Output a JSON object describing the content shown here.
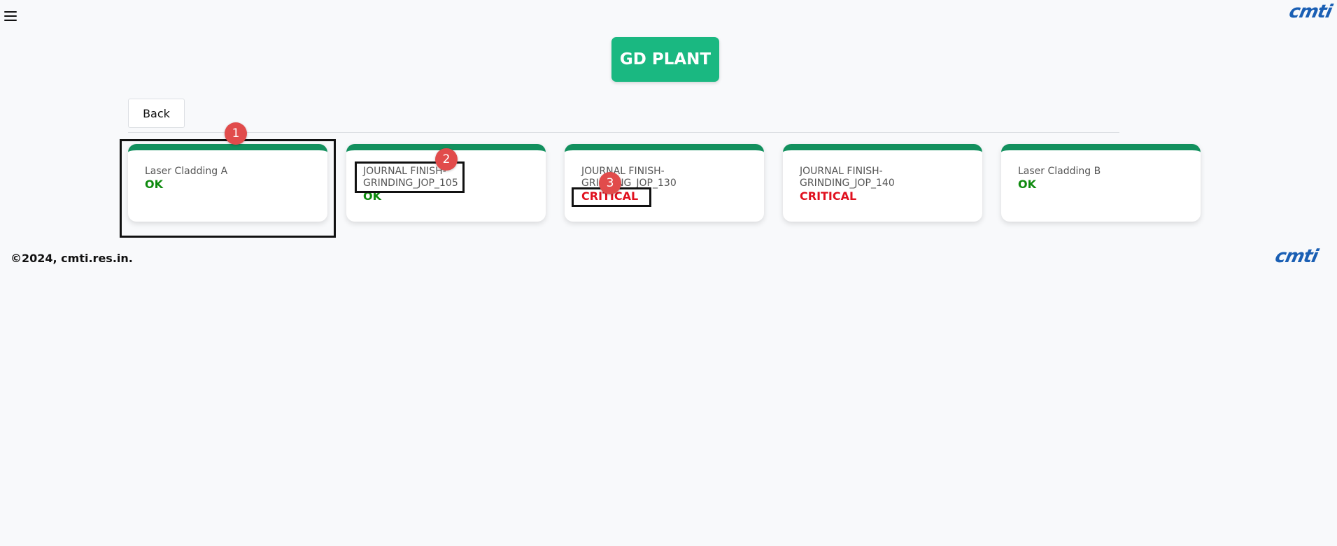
{
  "header": {
    "menu_icon": "hamburger-menu-icon",
    "logo_text": "cmti",
    "title": "GD PLANT"
  },
  "toolbar": {
    "back_label": "Back"
  },
  "machines": [
    {
      "name": "Laser Cladding A",
      "status": "OK",
      "status_color": "#0d8a0d"
    },
    {
      "name": "JOURNAL FINISH-GRINDING_JOP_105",
      "status": "OK",
      "status_color": "#0d8a0d"
    },
    {
      "name": "JOURNAL FINISH-GRINDING_JOP_130",
      "status": "CRITICAL",
      "status_color": "#e0101e"
    },
    {
      "name": "JOURNAL FINISH-GRINDING_JOP_140",
      "status": "CRITICAL",
      "status_color": "#e0101e"
    },
    {
      "name": "Laser Cladding B",
      "status": "OK",
      "status_color": "#0d8a0d"
    }
  ],
  "annotations": [
    "1",
    "2",
    "3"
  ],
  "footer": {
    "copyright": "©2024, cmti.res.in."
  },
  "colors": {
    "accent": "#1ab881",
    "card_top": "#12905e",
    "ok": "#0d8a0d",
    "critical": "#e0101e",
    "logo": "#1a5fb4"
  }
}
